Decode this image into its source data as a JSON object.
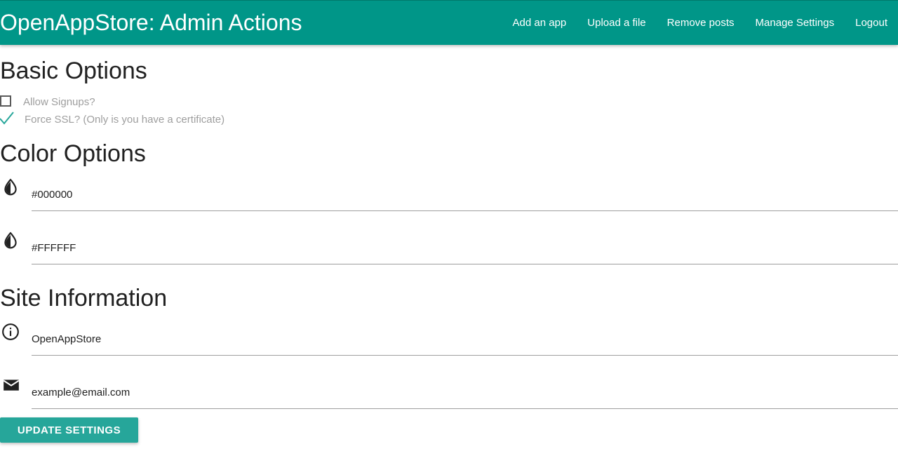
{
  "navbar": {
    "brand": "OpenAppStore: Admin Actions",
    "links": [
      "Add an app",
      "Upload a file",
      "Remove posts",
      "Manage Settings",
      "Logout"
    ]
  },
  "basic_options": {
    "title": "Basic Options",
    "allow_signups": {
      "label": "Allow Signups?",
      "checked": false
    },
    "force_ssl": {
      "label": "Force SSL? (Only is you have a certificate)",
      "checked": true
    }
  },
  "color_options": {
    "title": "Color Options",
    "primary_color": {
      "value": "#000000",
      "icon": "invert-colors-icon"
    },
    "secondary_color": {
      "value": "#FFFFFF",
      "icon": "invert-colors-icon"
    }
  },
  "site_information": {
    "title": "Site Information",
    "site_name": {
      "value": "OpenAppStore",
      "icon": "info-icon"
    },
    "site_email": {
      "value": "example@email.com",
      "icon": "email-icon"
    }
  },
  "update_button": {
    "label": "Update Settings"
  },
  "colors": {
    "primary": "#009688",
    "button": "#26a69a",
    "check_accent": "#26a69a"
  }
}
